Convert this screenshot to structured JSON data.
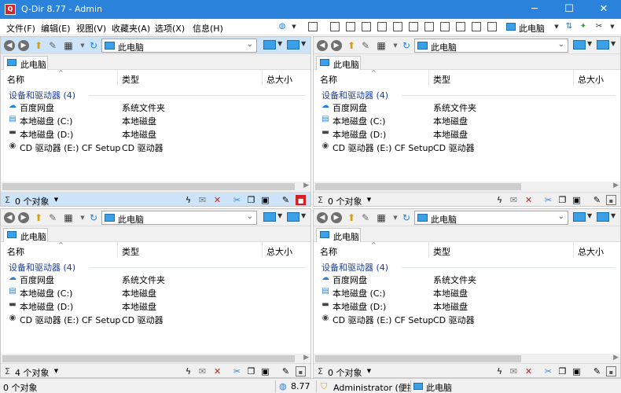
{
  "window": {
    "title": "Q-Dir 8.77 - Admin",
    "app_icon_glyph": "Q",
    "minimize_glyph": "─",
    "maximize_glyph": "☐",
    "close_glyph": "✕"
  },
  "menu": {
    "items": [
      "文件(F)",
      "编辑(E)",
      "视图(V)",
      "收藏夹(A)",
      "选项(X)",
      "信息(H)"
    ]
  },
  "toolbar": {
    "location_label": "此电脑"
  },
  "panes": [
    {
      "address": "此电脑",
      "tab_label": "此电脑",
      "columns": {
        "name": "名称",
        "type": "类型",
        "size": "总大小"
      },
      "group_label": "设备和驱动器 (4)",
      "items": [
        {
          "name": "百度网盘",
          "type": "系统文件夹",
          "icon": "baidu-cloud-icon"
        },
        {
          "name": "本地磁盘 (C:)",
          "type": "本地磁盘",
          "icon": "windows-drive-icon"
        },
        {
          "name": "本地磁盘 (D:)",
          "type": "本地磁盘",
          "icon": "hard-drive-icon"
        },
        {
          "name": "CD 驱动器 (E:) CF Setup",
          "type": "CD 驱动器",
          "icon": "cd-drive-icon"
        }
      ],
      "status_count": "0 个对象"
    },
    {
      "address": "此电脑",
      "tab_label": "此电脑",
      "columns": {
        "name": "名称",
        "type": "类型",
        "size": "总大小"
      },
      "group_label": "设备和驱动器 (4)",
      "items": [
        {
          "name": "百度网盘",
          "type": "系统文件夹",
          "icon": "baidu-cloud-icon"
        },
        {
          "name": "本地磁盘 (C:)",
          "type": "本地磁盘",
          "icon": "windows-drive-icon"
        },
        {
          "name": "本地磁盘 (D:)",
          "type": "本地磁盘",
          "icon": "hard-drive-icon"
        },
        {
          "name": "CD 驱动器 (E:) CF Setup",
          "type": "CD 驱动器",
          "icon": "cd-drive-icon"
        }
      ],
      "status_count": "0 个对象"
    },
    {
      "address": "此电脑",
      "tab_label": "此电脑",
      "columns": {
        "name": "名称",
        "type": "类型",
        "size": "总大小"
      },
      "group_label": "设备和驱动器 (4)",
      "items": [
        {
          "name": "百度网盘",
          "type": "系统文件夹",
          "icon": "baidu-cloud-icon"
        },
        {
          "name": "本地磁盘 (C:)",
          "type": "本地磁盘",
          "icon": "windows-drive-icon"
        },
        {
          "name": "本地磁盘 (D:)",
          "type": "本地磁盘",
          "icon": "hard-drive-icon"
        },
        {
          "name": "CD 驱动器 (E:) CF Setup",
          "type": "CD 驱动器",
          "icon": "cd-drive-icon"
        }
      ],
      "status_count": "4 个对象"
    },
    {
      "address": "此电脑",
      "tab_label": "此电脑",
      "columns": {
        "name": "名称",
        "type": "类型",
        "size": "总大小"
      },
      "group_label": "设备和驱动器 (4)",
      "items": [
        {
          "name": "百度网盘",
          "type": "系统文件夹",
          "icon": "baidu-cloud-icon"
        },
        {
          "name": "本地磁盘 (C:)",
          "type": "本地磁盘",
          "icon": "windows-drive-icon"
        },
        {
          "name": "本地磁盘 (D:)",
          "type": "本地磁盘",
          "icon": "hard-drive-icon"
        },
        {
          "name": "CD 驱动器 (E:) CF Setup",
          "type": "CD 驱动器",
          "icon": "cd-drive-icon"
        }
      ],
      "status_count": "0 个对象"
    }
  ],
  "bottombar": {
    "count": "0 个对象",
    "version": "8.77",
    "user": "Administrator (便携)",
    "location": "此电脑"
  },
  "colors": {
    "titlebar": "#2a82da",
    "active_pane": "#cde3f7",
    "group_text": "#1e3f9a"
  }
}
